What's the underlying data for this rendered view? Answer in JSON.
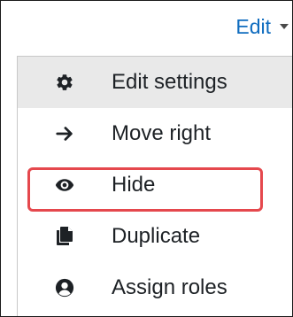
{
  "toggle": {
    "label": "Edit"
  },
  "menu": {
    "items": [
      {
        "label": "Edit settings",
        "icon": "gear-icon"
      },
      {
        "label": "Move right",
        "icon": "arrow-right-icon"
      },
      {
        "label": "Hide",
        "icon": "eye-icon"
      },
      {
        "label": "Duplicate",
        "icon": "copy-icon"
      },
      {
        "label": "Assign roles",
        "icon": "user-circle-icon"
      }
    ]
  },
  "colors": {
    "link": "#0f6cbf",
    "text": "#1d2125",
    "hover_bg": "#e9e9e9",
    "annotation": "#e5484d"
  }
}
